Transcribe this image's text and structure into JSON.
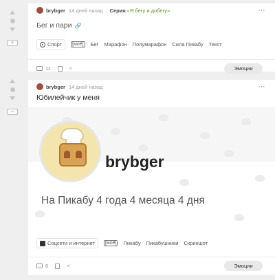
{
  "posts": [
    {
      "author": "brybger",
      "time": "14 дней назад",
      "series_label": "Серия",
      "series_name": "«Я бегу и добегу»",
      "title": "Бег и пари",
      "category": "Спорт",
      "mine": "[моё]",
      "tags": [
        "Бег",
        "Марафон",
        "Полумарафон",
        "Сила Пикабу",
        "Текст"
      ],
      "comments": "11",
      "emotions_button": "Эмоции",
      "toggle": "+"
    },
    {
      "author": "brybger",
      "time": "14 дней назад",
      "title": "Юбилейчик у меня",
      "image": {
        "name": "brybger",
        "tenure": "На Пикабу 4 года 4 месяца 4 дня"
      },
      "category": "Соцсети и интернет",
      "mine": "[моё]",
      "tags": [
        "Пикабу",
        "Пикабушники",
        "Скриншот"
      ],
      "comments": "6",
      "emotions_button": "Эмоции",
      "toggle": "–"
    }
  ],
  "icons": {
    "more": "⋯",
    "link": "🔗",
    "share": "<"
  },
  "colors": {
    "series_link": "#5c8f24",
    "emotions_bg": "#e9e9e9"
  }
}
